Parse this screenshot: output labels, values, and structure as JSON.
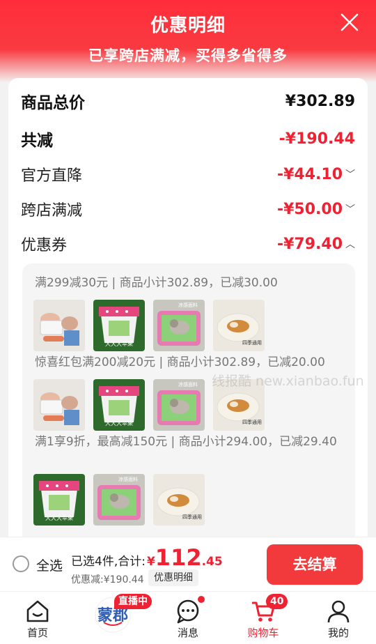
{
  "header": {
    "title": "优惠明细",
    "subtitle": "已享跨店满减，买得多省得多"
  },
  "summary": {
    "total_label": "商品总价",
    "total_value": "¥302.89",
    "reduce_label": "共减",
    "reduce_value": "-¥190.44",
    "rows": [
      {
        "label": "官方直降",
        "value": "-¥44.10",
        "chevron": "﹀"
      },
      {
        "label": "跨店满减",
        "value": "-¥50.00",
        "chevron": "﹀"
      },
      {
        "label": "优惠券",
        "value": "-¥79.40",
        "chevron": "︿"
      }
    ]
  },
  "coupon_groups": [
    {
      "text": "满299减30元 | 商品小计302.89，已减30.00"
    },
    {
      "text": "惊喜红包满200减20元 | 商品小计302.89，已减20.00"
    },
    {
      "text": "满1享9折，最高减150元 | 商品小计294.00，已减29.40"
    }
  ],
  "watermark": "线报酷 new.xianbao.fun",
  "checkout": {
    "select_all": "全选",
    "selected_label": "已选4件,合计:",
    "currency": "¥",
    "total_int": "112",
    "total_dec": ".45",
    "discount_text": "优惠减:¥190.44",
    "detail_button": "优惠明细",
    "pay_button": "去结算"
  },
  "nav": {
    "items": [
      {
        "label": "首页",
        "icon": "home-icon"
      },
      {
        "label": "",
        "icon": "live-logo-icon"
      },
      {
        "label": "消息",
        "icon": "message-icon"
      },
      {
        "label": "购物车",
        "icon": "cart-icon"
      },
      {
        "label": "我的",
        "icon": "profile-icon"
      }
    ],
    "live_badge": "直播中",
    "cart_count": "40"
  },
  "colors": {
    "brand_red": "#ee2233",
    "header_red": "#ff2d3a"
  }
}
